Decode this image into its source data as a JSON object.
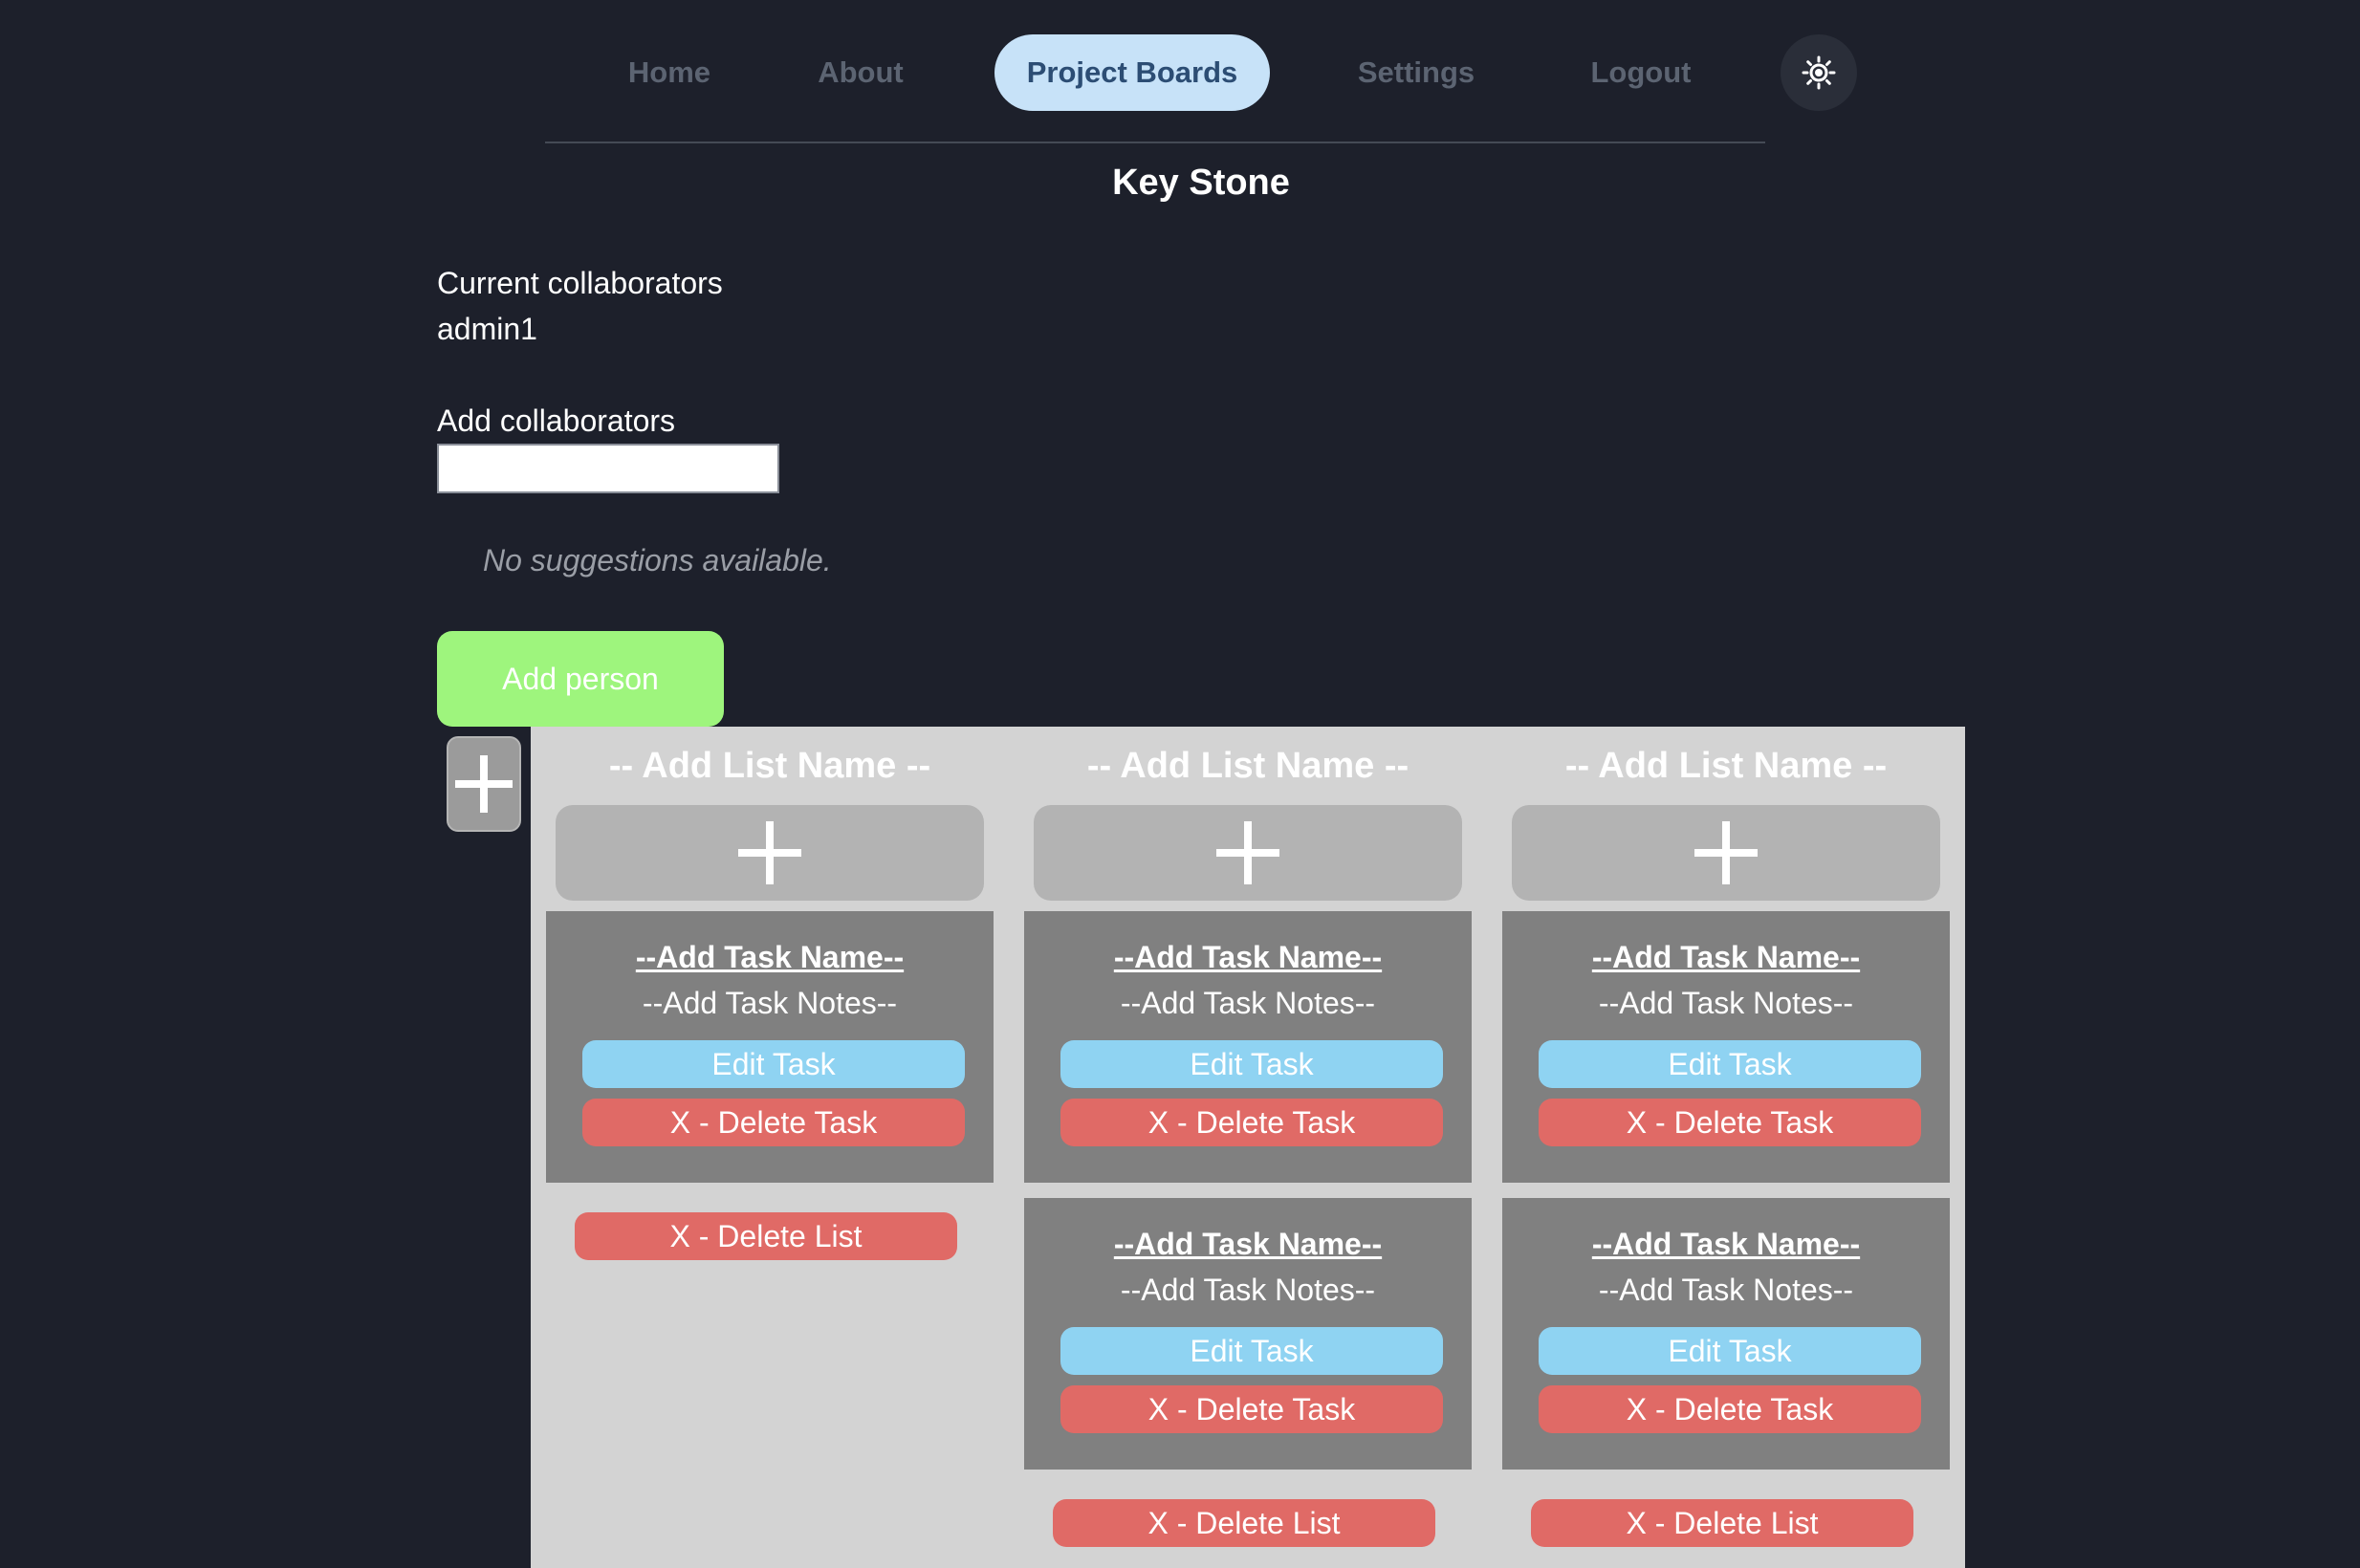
{
  "nav": {
    "items": [
      "Home",
      "About",
      "Project Boards",
      "Settings",
      "Logout"
    ],
    "active": "Project Boards",
    "theme_icon": "sun-icon"
  },
  "board": {
    "title": "Key Stone"
  },
  "collaborators": {
    "current_label": "Current collaborators",
    "current": [
      "admin1"
    ],
    "add_label": "Add collaborators",
    "input_value": "",
    "suggestions_text": "No suggestions available.",
    "add_button": "Add person"
  },
  "add_list_icon": "plus-icon",
  "lists": [
    {
      "name": "-- Add List Name --",
      "tasks": [
        {
          "name": "--Add Task Name--",
          "notes": "--Add Task Notes--",
          "edit": "Edit Task",
          "delete": "X - Delete Task"
        }
      ],
      "delete_label": "X - Delete List"
    },
    {
      "name": "-- Add List Name --",
      "tasks": [
        {
          "name": "--Add Task Name--",
          "notes": "--Add Task Notes--",
          "edit": "Edit Task",
          "delete": "X - Delete Task"
        },
        {
          "name": "--Add Task Name--",
          "notes": "--Add Task Notes--",
          "edit": "Edit Task",
          "delete": "X - Delete Task"
        }
      ],
      "delete_label": "X - Delete List"
    },
    {
      "name": "-- Add List Name --",
      "tasks": [
        {
          "name": "--Add Task Name--",
          "notes": "--Add Task Notes--",
          "edit": "Edit Task",
          "delete": "X - Delete Task"
        },
        {
          "name": "--Add Task Name--",
          "notes": "--Add Task Notes--",
          "edit": "Edit Task",
          "delete": "X - Delete Task"
        }
      ],
      "delete_label": "X - Delete List"
    }
  ],
  "colors": {
    "background": "#1d202b",
    "nav_active_bg": "#c7e2f8",
    "add_person_bg": "#9ef57d",
    "edit_bg": "#8fd3f2",
    "delete_bg": "#e06a66",
    "board_bg": "#d3d3d3",
    "task_bg": "#808080"
  }
}
